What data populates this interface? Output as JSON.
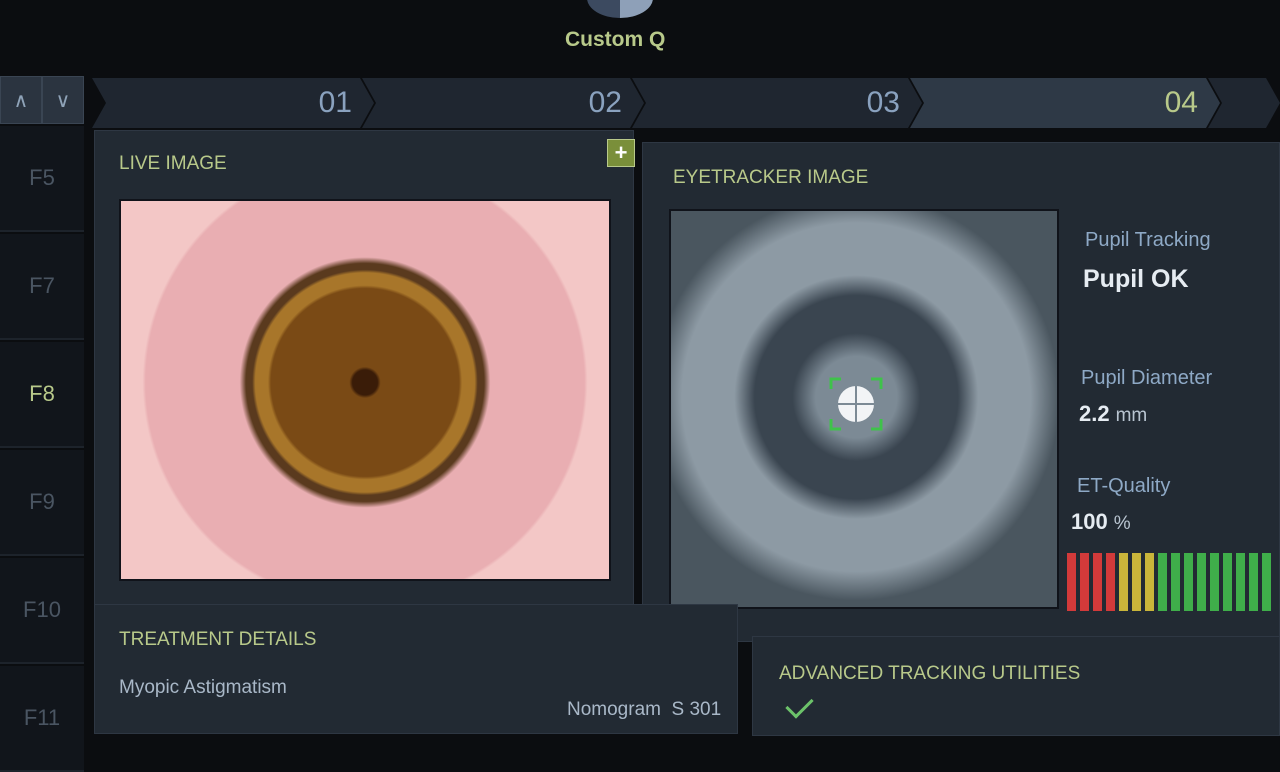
{
  "app": {
    "title": "Custom Q"
  },
  "nav": {
    "up": "∧",
    "down": "∨"
  },
  "fkeys": [
    {
      "label": "F5",
      "active": false
    },
    {
      "label": "F7",
      "active": false
    },
    {
      "label": "F8",
      "active": true
    },
    {
      "label": "F9",
      "active": false
    },
    {
      "label": "F10",
      "active": false
    },
    {
      "label": "F11",
      "active": false
    }
  ],
  "steps": [
    {
      "label": "01",
      "active": false
    },
    {
      "label": "02",
      "active": false
    },
    {
      "label": "03",
      "active": false
    },
    {
      "label": "04",
      "active": true
    }
  ],
  "live": {
    "title": "LIVE IMAGE",
    "add_label": "+"
  },
  "eyetracker": {
    "title": "EYETRACKER IMAGE",
    "pupil_tracking_label": "Pupil Tracking",
    "pupil_tracking_value": "Pupil OK",
    "pupil_diameter_label": "Pupil Diameter",
    "pupil_diameter_value": "2.2",
    "pupil_diameter_unit": "mm",
    "et_quality_label": "ET-Quality",
    "et_quality_value": "100",
    "et_quality_unit": "%",
    "quality_level": 1.0
  },
  "treatment": {
    "title": "TREATMENT DETAILS",
    "type": "Myopic Astigmatism",
    "nomogram": "Nomogram  S 301"
  },
  "tracking": {
    "title": "ADVANCED TRACKING UTILITIES"
  },
  "colors": {
    "accent": "#b8c98a",
    "red": "#d23a3a",
    "yellow": "#c9b53a",
    "green": "#3fae4a"
  }
}
